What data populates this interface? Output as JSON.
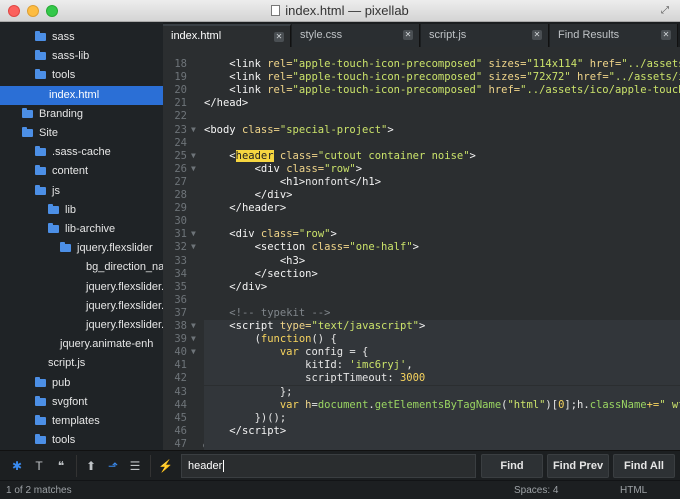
{
  "window": {
    "title": "index.html — pixellab"
  },
  "sidebar": {
    "items": [
      {
        "label": "sass",
        "type": "folder",
        "depth": 2
      },
      {
        "label": "sass-lib",
        "type": "folder",
        "depth": 2
      },
      {
        "label": "tools",
        "type": "folder",
        "depth": 2
      },
      {
        "label": "index.html",
        "type": "file",
        "depth": 2,
        "selected": true
      },
      {
        "label": "Branding",
        "type": "folder",
        "depth": 1
      },
      {
        "label": "Site",
        "type": "folder",
        "depth": 1
      },
      {
        "label": ".sass-cache",
        "type": "folder",
        "depth": 2
      },
      {
        "label": "content",
        "type": "folder",
        "depth": 2
      },
      {
        "label": "js",
        "type": "folder",
        "depth": 2
      },
      {
        "label": "lib",
        "type": "folder",
        "depth": 3
      },
      {
        "label": "lib-archive",
        "type": "folder",
        "depth": 3
      },
      {
        "label": "jquery.flexslider",
        "type": "folder",
        "depth": 4
      },
      {
        "label": "bg_direction_nav",
        "type": "file",
        "depth": 5
      },
      {
        "label": "jquery.flexslider.",
        "type": "file",
        "depth": 5
      },
      {
        "label": "jquery.flexslider.",
        "type": "file",
        "depth": 5
      },
      {
        "label": "jquery.flexslider.",
        "type": "file",
        "depth": 5
      },
      {
        "label": "jquery.animate-enh",
        "type": "file",
        "depth": 4
      },
      {
        "label": "script.js",
        "type": "file",
        "depth": 3
      },
      {
        "label": "pub",
        "type": "folder",
        "depth": 2
      },
      {
        "label": "svgfont",
        "type": "folder",
        "depth": 2
      },
      {
        "label": "templates",
        "type": "folder",
        "depth": 2
      },
      {
        "label": "tools",
        "type": "folder",
        "depth": 2
      }
    ]
  },
  "tabs": [
    {
      "label": "index.html",
      "active": true
    },
    {
      "label": "style.css",
      "active": false
    },
    {
      "label": "script.js",
      "active": false
    },
    {
      "label": "Find Results",
      "active": false
    }
  ],
  "editor": {
    "lines": [
      {
        "n": "18",
        "fold": "",
        "html": "    <span class=\"tg\">&lt;link</span> <span class=\"at\">rel=</span><span class=\"st\">\"apple-touch-icon-precomposed\"</span> <span class=\"at\">sizes=</span><span class=\"st\">\"114x114\"</span> <span class=\"at\">href=</span><span class=\"st\">\"../assets/i</span>"
      },
      {
        "n": "19",
        "fold": "",
        "html": "    <span class=\"tg\">&lt;link</span> <span class=\"at\">rel=</span><span class=\"st\">\"apple-touch-icon-precomposed\"</span> <span class=\"at\">sizes=</span><span class=\"st\">\"72x72\"</span> <span class=\"at\">href=</span><span class=\"st\">\"../assets/ic</span>"
      },
      {
        "n": "20",
        "fold": "",
        "html": "    <span class=\"tg\">&lt;link</span> <span class=\"at\">rel=</span><span class=\"st\">\"apple-touch-icon-precomposed\"</span> <span class=\"at\">href=</span><span class=\"st\">\"../assets/ico/apple-touch-i</span>"
      },
      {
        "n": "21",
        "fold": "",
        "html": "<span class=\"tg\">&lt;/head&gt;</span>"
      },
      {
        "n": "22",
        "fold": "",
        "html": ""
      },
      {
        "n": "23",
        "fold": "▼",
        "html": "<span class=\"tg\">&lt;body</span> <span class=\"at\">class=</span><span class=\"st\">\"special-project\"</span><span class=\"tg\">&gt;</span>"
      },
      {
        "n": "24",
        "fold": "",
        "html": ""
      },
      {
        "n": "25",
        "fold": "▼",
        "html": "    <span class=\"tg\">&lt;<span class=\"match\">header</span></span> <span class=\"at\">class=</span><span class=\"st\">\"cutout container noise\"</span><span class=\"tg\">&gt;</span>"
      },
      {
        "n": "26",
        "fold": "▼",
        "html": "        <span class=\"tg\">&lt;div</span> <span class=\"at\">class=</span><span class=\"st\">\"row\"</span><span class=\"tg\">&gt;</span>"
      },
      {
        "n": "27",
        "fold": "",
        "html": "            <span class=\"tg\">&lt;h1&gt;</span>nonfont<span class=\"tg\">&lt;/h1&gt;</span>"
      },
      {
        "n": "28",
        "fold": "",
        "html": "        <span class=\"tg\">&lt;/div&gt;</span>"
      },
      {
        "n": "29",
        "fold": "",
        "html": "    <span class=\"tg\">&lt;/header&gt;</span>"
      },
      {
        "n": "30",
        "fold": "",
        "html": ""
      },
      {
        "n": "31",
        "fold": "▼",
        "html": "    <span class=\"tg\">&lt;div</span> <span class=\"at\">class=</span><span class=\"st\">\"row\"</span><span class=\"tg\">&gt;</span>"
      },
      {
        "n": "32",
        "fold": "▼",
        "html": "        <span class=\"tg\">&lt;section</span> <span class=\"at\">class=</span><span class=\"st\">\"one-half\"</span><span class=\"tg\">&gt;</span>"
      },
      {
        "n": "33",
        "fold": "",
        "html": "            <span class=\"tg\">&lt;h3&gt;</span>"
      },
      {
        "n": "34",
        "fold": "",
        "html": "        <span class=\"tg\">&lt;/section&gt;</span>"
      },
      {
        "n": "35",
        "fold": "",
        "html": "    <span class=\"tg\">&lt;/div&gt;</span>"
      },
      {
        "n": "36",
        "fold": "",
        "html": ""
      },
      {
        "n": "37",
        "fold": "",
        "html": "    <span class=\"cm\">&lt;!-- typekit --&gt;</span>"
      },
      {
        "n": "38",
        "fold": "▼",
        "html": "    <span class=\"tg\">&lt;script</span> <span class=\"at\">type=</span><span class=\"st\">\"text/javascript\"</span><span class=\"tg\">&gt;</span>"
      },
      {
        "n": "39",
        "fold": "▼",
        "html": "        (<span class=\"kw\">function</span>() {"
      },
      {
        "n": "40",
        "fold": "▼",
        "html": "            <span class=\"kw\">var</span> config = {"
      },
      {
        "n": "41",
        "fold": "",
        "html": "                kitId: <span class=\"st\">'imc6ryj'</span>,"
      },
      {
        "n": "42",
        "fold": "",
        "html": "                scriptTimeout: <span class=\"nm\">3000</span>"
      },
      {
        "n": "43",
        "fold": "",
        "html": "            };"
      },
      {
        "n": "44",
        "fold": "",
        "html": "            <span class=\"kw\">var</span> <span class=\"at\">h</span>=<span class=\"fn\">document</span>.<span class=\"fn\">getElementsByTagName</span>(<span class=\"st\">\"html\"</span>)[<span class=\"nm\">0</span>];h.<span class=\"fn\">className</span><span class=\"kw\">+=</span><span class=\"st\">\" wf-l</span>"
      },
      {
        "n": "45",
        "fold": "",
        "html": "        })();"
      },
      {
        "n": "46",
        "fold": "",
        "html": "    <span class=\"tg\">&lt;/script&gt;</span>"
      },
      {
        "n": "47",
        "fold": "",
        "html": ""
      }
    ]
  },
  "findbar": {
    "query": "header",
    "find_label": "Find",
    "find_prev_label": "Find Prev",
    "find_all_label": "Find All"
  },
  "status": {
    "matches": "1 of 2 matches",
    "spaces": "Spaces: 4",
    "syntax": "HTML"
  }
}
